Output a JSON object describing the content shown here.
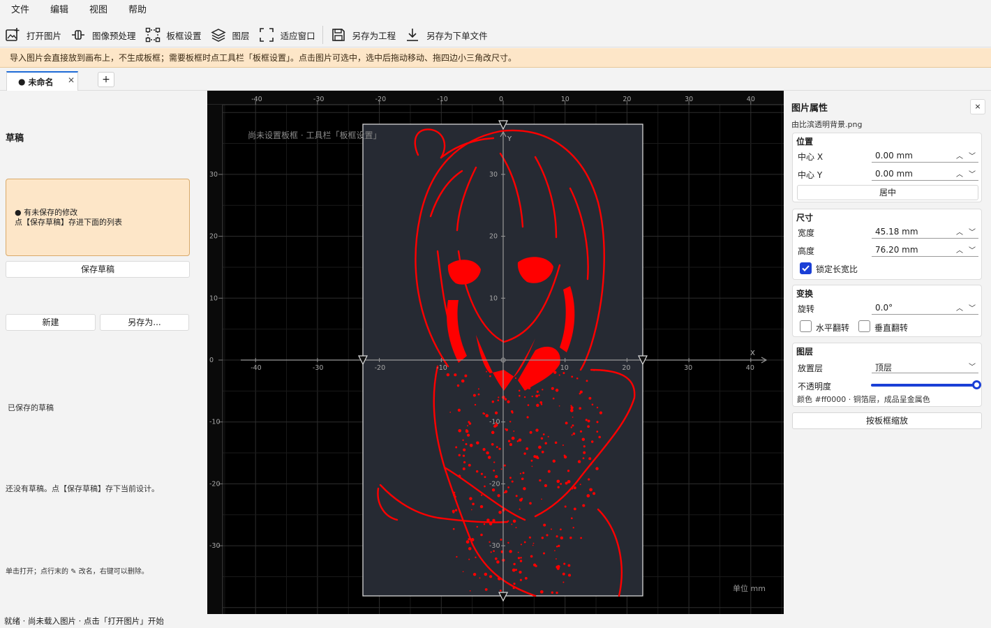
{
  "menu": [
    "文件",
    "编辑",
    "视图",
    "帮助"
  ],
  "toolbar": {
    "open_image": "打开图片",
    "preprocess": "图像预处理",
    "frame_settings": "板框设置",
    "layers": "图层",
    "fit_window": "适应窗口",
    "save_project": "另存为工程",
    "save_order": "另存为下单文件"
  },
  "notice": "导入图片会直接放到画布上，不生成板框；需要板框时点工具栏「板框设置」。点击图片可选中，选中后拖动移动、拖四边小三角改尺寸。",
  "tab": {
    "label": "未命名",
    "close": "✕",
    "add": "+"
  },
  "left": {
    "title": "草稿",
    "unsaved_line1": "● 有未保存的修改",
    "unsaved_line2": "点【保存草稿】存进下面的列表",
    "save_draft": "保存草稿",
    "new": "新建",
    "save_as": "另存为...",
    "saved_label": "已保存的草稿",
    "no_draft": "还没有草稿。点【保存草稿】存下当前设计。",
    "hint": "单击打开；点行末的 ✎ 改名，右键可以删除。"
  },
  "canvas": {
    "overlay_text": "尚未设置板框  ·  工具栏「板框设置」",
    "unit": "单位 mm",
    "x_label": "X",
    "y_label": "Y",
    "top_ticks": [
      "-40",
      "-30",
      "-20",
      "-10",
      "0",
      "10",
      "20",
      "30",
      "40"
    ],
    "axis_x_ticks": [
      "-40",
      "-30",
      "-20",
      "-10",
      "10",
      "20",
      "30",
      "40"
    ],
    "left_ticks": [
      "30",
      "20",
      "10",
      "0",
      "-10",
      "-20",
      "-30"
    ],
    "axis_y_ticks": [
      "30",
      "20",
      "10",
      "-10",
      "-20",
      "-30"
    ],
    "image_color": "#ff0000"
  },
  "right": {
    "title": "图片属性",
    "close": "×",
    "filename": "由比滨透明背景.png",
    "position": {
      "title": "位置",
      "cx_label": "中心 X",
      "cx_value": "0.00 mm",
      "cy_label": "中心 Y",
      "cy_value": "0.00 mm",
      "center_btn": "居中"
    },
    "size": {
      "title": "尺寸",
      "w_label": "宽度",
      "w_value": "45.18 mm",
      "h_label": "高度",
      "h_value": "76.20 mm",
      "lock_label": "锁定长宽比",
      "lock_checked": true
    },
    "transform": {
      "title": "变换",
      "rot_label": "旋转",
      "rot_value": "0.0°",
      "hflip_label": "水平翻转",
      "vflip_label": "垂直翻转"
    },
    "layer": {
      "title": "图层",
      "place_label": "放置层",
      "place_value": "顶层",
      "opacity_label": "不透明度",
      "opacity": 1.0,
      "info": "颜色 #ff0000  ·  铜箔层，成品呈金属色"
    },
    "scale_btn": "按板框缩放"
  },
  "status": "就绪  ·  尚未载入图片  ·  点击「打开图片」开始"
}
